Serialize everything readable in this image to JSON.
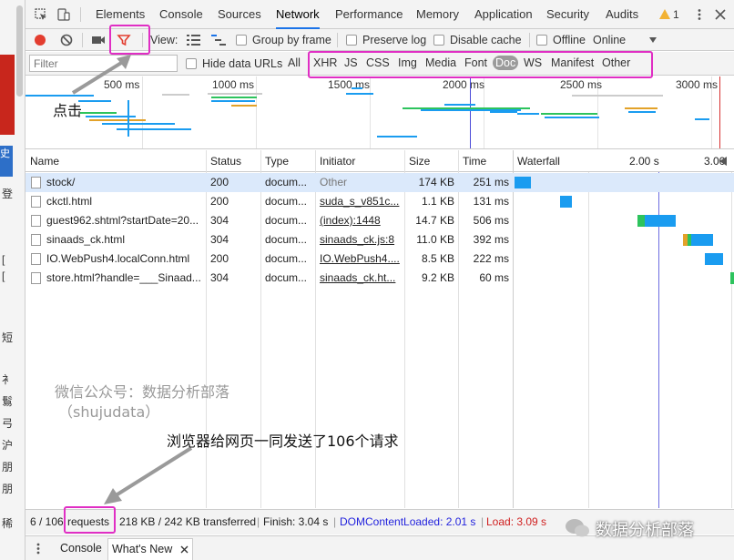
{
  "tabs": [
    {
      "label": "Elements"
    },
    {
      "label": "Console"
    },
    {
      "label": "Sources"
    },
    {
      "label": "Network"
    },
    {
      "label": "Performance"
    },
    {
      "label": "Memory"
    },
    {
      "label": "Application"
    },
    {
      "label": "Security"
    },
    {
      "label": "Audits"
    }
  ],
  "warning_count": "1",
  "toolbar": {
    "view_label": "View:",
    "group_by_frame": "Group by frame",
    "preserve_log": "Preserve log",
    "disable_cache": "Disable cache",
    "offline": "Offline",
    "throttle": "Online"
  },
  "filter": {
    "placeholder": "Filter",
    "hide_data_urls": "Hide data URLs",
    "all": "All",
    "types": [
      "XHR",
      "JS",
      "CSS",
      "Img",
      "Media",
      "Font",
      "Doc",
      "WS",
      "Manifest",
      "Other"
    ],
    "selected_type": "Doc"
  },
  "overview": {
    "ticks": [
      "500 ms",
      "1000 ms",
      "1500 ms",
      "2000 ms",
      "2500 ms",
      "3000 ms"
    ]
  },
  "table": {
    "headers": {
      "name": "Name",
      "status": "Status",
      "type": "Type",
      "initiator": "Initiator",
      "size": "Size",
      "time": "Time",
      "waterfall": "Waterfall",
      "wf_tick1": "2.00 s",
      "wf_tick2": "3.00"
    },
    "rows": [
      {
        "name": "stock/",
        "status": "200",
        "type": "docum...",
        "initiator": "Other",
        "size": "174 KB",
        "time": "251 ms"
      },
      {
        "name": "ckctl.html",
        "status": "200",
        "type": "docum...",
        "initiator": "suda_s_v851c...",
        "size": "1.1 KB",
        "time": "131 ms"
      },
      {
        "name": "guest962.shtml?startDate=20...",
        "status": "304",
        "type": "docum...",
        "initiator": "(index):1448",
        "size": "14.7 KB",
        "time": "506 ms"
      },
      {
        "name": "sinaads_ck.html",
        "status": "304",
        "type": "docum...",
        "initiator": "sinaads_ck.js:8",
        "size": "11.0 KB",
        "time": "392 ms"
      },
      {
        "name": "IO.WebPush4.localConn.html",
        "status": "200",
        "type": "docum...",
        "initiator": "IO.WebPush4....",
        "size": "8.5 KB",
        "time": "222 ms"
      },
      {
        "name": "store.html?handle=___Sinaad...",
        "status": "304",
        "type": "docum...",
        "initiator": "sinaads_ck.ht...",
        "size": "9.2 KB",
        "time": "60 ms"
      }
    ]
  },
  "status": {
    "count": "6 / 106",
    "requests_word": "requests",
    "transferred": "218 KB / 242 KB transferred",
    "finish": "Finish: 3.04 s",
    "dom": "DOMContentLoaded: 2.01 s",
    "load": "Load: 3.09 s",
    "dom_color": "#2222dd",
    "load_color": "#d02020"
  },
  "drawer": {
    "console": "Console",
    "whats_new": "What's New"
  },
  "annotations": {
    "click": "点击",
    "requests_note": "浏览器给网页一同发送了106个请求",
    "watermark1": "微信公众号：数据分析部落",
    "watermark2": "（shujudata）",
    "logo": "数据分析部落"
  },
  "left_strip": {
    "chars": [
      "史",
      "登",
      "[",
      "[",
      "短",
      "衤",
      "鬄",
      "弓",
      "沪",
      "朋",
      "朋",
      "稀"
    ]
  },
  "colors": {
    "highlight": "#e02ec4",
    "active_tab": "#1a73e8",
    "record": "#e33d2f",
    "waterfall_bar": "#1a9cf0"
  }
}
